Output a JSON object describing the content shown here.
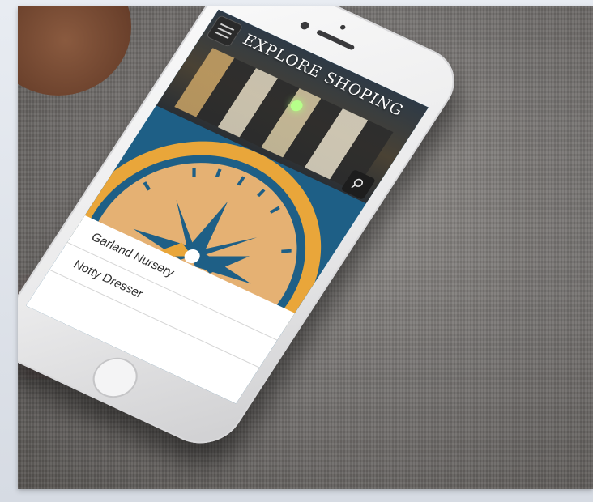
{
  "app": {
    "title": "EXPLORE SHOPING",
    "search_icon": "search-icon",
    "menu_icon": "menu-icon"
  },
  "list": {
    "items": [
      {
        "label": "Garland Nursery"
      },
      {
        "label": "Notty Dresser"
      }
    ]
  },
  "colors": {
    "primary_blue": "#1e5f86",
    "compass_orange": "#e9a63a",
    "compass_face": "#e5b173",
    "header_dark": "#2e3a46"
  }
}
